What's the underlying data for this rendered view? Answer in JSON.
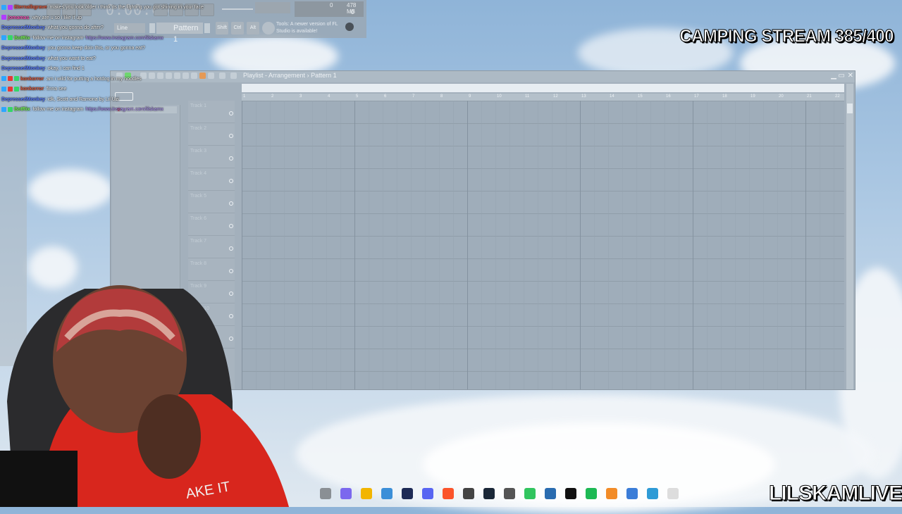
{
  "fl_studio": {
    "time": "0:00:00",
    "memory": {
      "value": "478 MB",
      "top": "0",
      "bottom": "0"
    },
    "snap": "Line",
    "pattern": "Pattern 1",
    "keys": [
      "Shift",
      "Ctrl",
      "Alt"
    ],
    "update_hint": "Tools: A newer version of FL Studio is available!",
    "playlist": {
      "title": "Playlist - Arrangement",
      "separator": "›",
      "pattern": "Pattern 1",
      "picker_item": "Pattern 1",
      "tracks": [
        "Track 1",
        "Track 2",
        "Track 3",
        "Track 4",
        "Track 5",
        "Track 6",
        "Track 7",
        "Track 8",
        "Track 9",
        "Track 10",
        "Track 11"
      ],
      "ruler": [
        "1",
        "2",
        "3",
        "4",
        "5",
        "6",
        "7",
        "8",
        "9",
        "10",
        "11",
        "12",
        "13",
        "14",
        "15",
        "16",
        "17",
        "18",
        "19",
        "20",
        "21",
        "22"
      ],
      "window_controls": {
        "minimize": "▁",
        "maximize": "▭",
        "close": "✕"
      }
    }
  },
  "chat": [
    {
      "user": "Eternalbgrave",
      "text": "makes you look older i think its the lighting you got shining in your face",
      "color": "#e05a3c",
      "badges": [
        "#2ea6ff",
        "#b13cff"
      ]
    },
    {
      "user": "jomamas",
      "text": "why are u so i like it up",
      "color": "#ff5bbd",
      "badges": [
        "#b13cff"
      ]
    },
    {
      "user": "DepressedMonkey",
      "text": "what you gonna do after?",
      "color": "#5a7cff",
      "badges": []
    },
    {
      "user": "BotRix",
      "text": "follow me on instagram",
      "link": "https://www.instagram.com/lilskamx",
      "color": "#7cff5a",
      "badges": [
        "#2ea6ff",
        "#35d66a"
      ]
    },
    {
      "user": "DepressedMonkey",
      "text": "you gonna keep doin this, or you gonna eat?",
      "color": "#5a7cff",
      "badges": []
    },
    {
      "user": "DepressedMonkey",
      "text": "what you want to eat?",
      "color": "#5a7cff",
      "badges": []
    },
    {
      "user": "DepressedMonkey",
      "text": "okay, i can find 1",
      "color": "#5a7cff",
      "badges": []
    },
    {
      "user": "konkorror",
      "text": "am i wild for putting a hotdog in my noodles",
      "color": "#e05a3c",
      "badges": [
        "#2ea6ff",
        "#e53935",
        "#35d66a"
      ]
    },
    {
      "user": "konkorror",
      "text": "finna see",
      "color": "#e05a3c",
      "badges": [
        "#2ea6ff",
        "#e53935",
        "#35d66a"
      ]
    },
    {
      "user": "DepressedMonkey",
      "text": "idk, Scott and Ramona by Lil Uzi",
      "color": "#5a7cff",
      "badges": []
    },
    {
      "user": "BotRix",
      "text": "follow me on instagram",
      "link": "https://www.instagram.com/lilskamx",
      "color": "#7cff5a",
      "badges": [
        "#2ea6ff",
        "#35d66a"
      ]
    }
  ],
  "overlay": {
    "stream_title": "CAMPING STREAM 385/400",
    "channel": "LILSKAMLIVE"
  },
  "taskbar_icons": [
    "widgets-icon",
    "copilot-icon",
    "file-explorer-icon",
    "store-icon",
    "photoshop-icon",
    "discord-icon",
    "brave-icon",
    "obs-icon",
    "steam-icon",
    "keyboard-icon",
    "streamlabs-icon",
    "4k-downloader-icon",
    "capcut-icon",
    "spotify-icon",
    "fl-studio-icon",
    "notepad-icon",
    "photos-icon",
    "file-icon"
  ]
}
